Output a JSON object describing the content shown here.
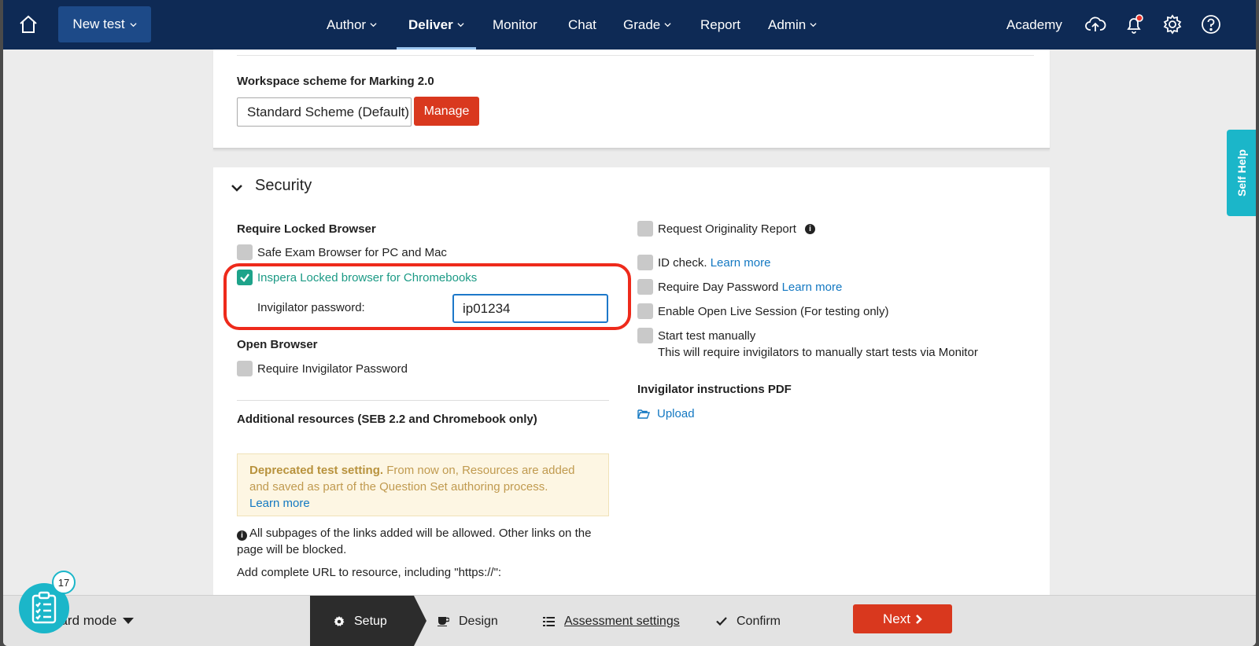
{
  "nav": {
    "new_test": "New test",
    "items": [
      "Author",
      "Deliver",
      "Monitor",
      "Chat",
      "Grade",
      "Report",
      "Admin"
    ],
    "academy": "Academy"
  },
  "workspace": {
    "label": "Workspace scheme for Marking 2.0",
    "scheme": "Standard Scheme (Default)",
    "manage": "Manage"
  },
  "security": {
    "title": "Security",
    "require_locked_browser": "Require Locked Browser",
    "seb": "Safe Exam Browser for PC and Mac",
    "inspera": "Inspera Locked browser for Chromebooks",
    "invigilator_password_label": "Invigilator password:",
    "invigilator_password_value": "ip01234",
    "open_browser": "Open Browser",
    "require_invigilator_password": "Require Invigilator Password",
    "additional_resources": "Additional resources (SEB 2.2 and Chromebook only)",
    "deprecated_bold": "Deprecated test setting.",
    "deprecated_text": " From now on, Resources are added and saved as part of the Question Set authoring process.",
    "learn_more": "Learn more",
    "subpages_note": "All subpages of the links added will be allowed. Other links on the page will be blocked.",
    "add_url": "Add complete URL to resource, including \"https://\":",
    "originality": "Request Originality Report",
    "id_check": "ID check.",
    "day_password": "Require Day Password",
    "open_live": "Enable Open Live Session (For testing only)",
    "start_manually": "Start test manually",
    "start_manually_desc": "This will require invigilators to manually start tests via Monitor",
    "instructions_pdf": "Invigilator instructions PDF",
    "upload": "Upload"
  },
  "selfhelp": "Self Help",
  "bottom": {
    "mode": "dard mode",
    "steps": [
      "Setup",
      "Design",
      "Assessment settings",
      "Confirm"
    ],
    "next": "Next",
    "badge": "17"
  },
  "colors": {
    "nav": "#0e2a55",
    "accent_red": "#d9381e",
    "check_green": "#1ea38a",
    "link": "#1378c2",
    "teal": "#1bb6c9"
  }
}
